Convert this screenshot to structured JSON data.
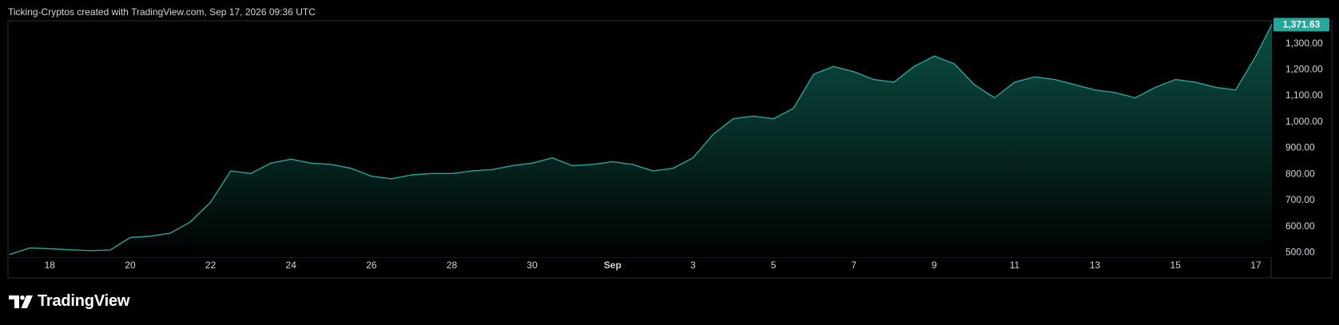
{
  "header": {
    "publisher": "Ticking-Cryptos",
    "created_with": "created with TradingView.com,",
    "date": "Sep 17, 2026 09:36 UTC"
  },
  "branding": {
    "logo_text": "TradingView"
  },
  "colors": {
    "background": "#000000",
    "line": "#26a69a",
    "fill_top": "#0d4f45",
    "price_label_bg": "#26a69a",
    "text": "#d1d4dc",
    "border": "#2a2e39"
  },
  "chart_data": {
    "type": "area",
    "x_ticks": [
      "18",
      "20",
      "22",
      "24",
      "26",
      "28",
      "30",
      "Sep",
      "3",
      "5",
      "7",
      "9",
      "11",
      "13",
      "15",
      "17"
    ],
    "y_ticks": [
      "500.00",
      "600.00",
      "700.00",
      "800.00",
      "900.00",
      "1,000.00",
      "1,100.00",
      "1,200.00",
      "1,300.00"
    ],
    "ylim": [
      480,
      1385
    ],
    "last_price": 1371.63,
    "last_price_label": "1,371.63",
    "grid": false,
    "series": [
      {
        "x": [
          "2026-08-17T00:00",
          "2026-08-17T12:00",
          "2026-08-18T00:00",
          "2026-08-18T12:00",
          "2026-08-19T00:00",
          "2026-08-19T12:00",
          "2026-08-20T00:00",
          "2026-08-20T12:00",
          "2026-08-21T00:00",
          "2026-08-21T12:00",
          "2026-08-22T00:00",
          "2026-08-22T12:00",
          "2026-08-23T00:00",
          "2026-08-23T12:00",
          "2026-08-24T00:00",
          "2026-08-24T12:00",
          "2026-08-25T00:00",
          "2026-08-25T12:00",
          "2026-08-26T00:00",
          "2026-08-26T12:00",
          "2026-08-27T00:00",
          "2026-08-27T12:00",
          "2026-08-28T00:00",
          "2026-08-28T12:00",
          "2026-08-29T00:00",
          "2026-08-29T12:00",
          "2026-08-30T00:00",
          "2026-08-30T12:00",
          "2026-08-31T00:00",
          "2026-08-31T12:00",
          "2026-09-01T00:00",
          "2026-09-01T12:00",
          "2026-09-02T00:00",
          "2026-09-02T12:00",
          "2026-09-03T00:00",
          "2026-09-03T12:00",
          "2026-09-04T00:00",
          "2026-09-04T12:00",
          "2026-09-05T00:00",
          "2026-09-05T12:00",
          "2026-09-06T00:00",
          "2026-09-06T12:00",
          "2026-09-07T00:00",
          "2026-09-07T12:00",
          "2026-09-08T00:00",
          "2026-09-08T12:00",
          "2026-09-09T00:00",
          "2026-09-09T12:00",
          "2026-09-10T00:00",
          "2026-09-10T12:00",
          "2026-09-11T00:00",
          "2026-09-11T12:00",
          "2026-09-12T00:00",
          "2026-09-12T12:00",
          "2026-09-13T00:00",
          "2026-09-13T12:00",
          "2026-09-14T00:00",
          "2026-09-14T12:00",
          "2026-09-15T00:00",
          "2026-09-15T12:00",
          "2026-09-16T00:00",
          "2026-09-16T12:00",
          "2026-09-17T00:00",
          "2026-09-17T09:36"
        ],
        "values": [
          490,
          515,
          512,
          508,
          505,
          507,
          555,
          560,
          572,
          615,
          690,
          810,
          800,
          840,
          855,
          840,
          835,
          820,
          790,
          780,
          795,
          800,
          800,
          810,
          815,
          830,
          840,
          860,
          830,
          835,
          845,
          835,
          810,
          820,
          860,
          950,
          1010,
          1020,
          1010,
          1050,
          1180,
          1210,
          1190,
          1160,
          1150,
          1210,
          1250,
          1220,
          1140,
          1090,
          1150,
          1170,
          1160,
          1140,
          1120,
          1110,
          1090,
          1130,
          1160,
          1150,
          1130,
          1120,
          1250,
          1371.63
        ]
      }
    ]
  }
}
